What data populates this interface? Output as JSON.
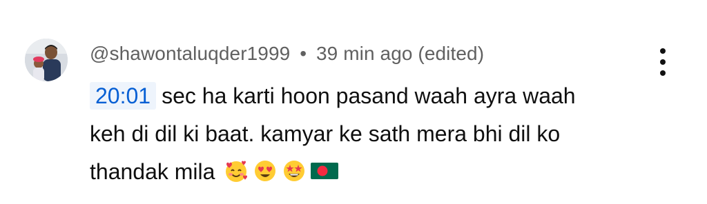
{
  "comment": {
    "username": "@shawontaluqder1999",
    "separator": "•",
    "time_ago": "39 min ago (edited)",
    "timestamp_link": "20:01",
    "text_line1": "sec ha karti hoon pasand waah ayra waah",
    "text_line2": "keh di dil ki baat. kamyar ke sath mera bhi dil ko",
    "text_line3": "thandak mila",
    "emojis": [
      "smiling-face-with-hearts-icon",
      "heart-eyes-icon",
      "star-struck-icon",
      "bangladesh-flag-icon"
    ]
  },
  "colors": {
    "meta_text": "#606060",
    "body_text": "#0f0f0f",
    "timestamp_link": "#065fd4",
    "timestamp_bg": "#eef4fc",
    "flag_green": "#006a4e",
    "flag_red": "#f42a41"
  }
}
